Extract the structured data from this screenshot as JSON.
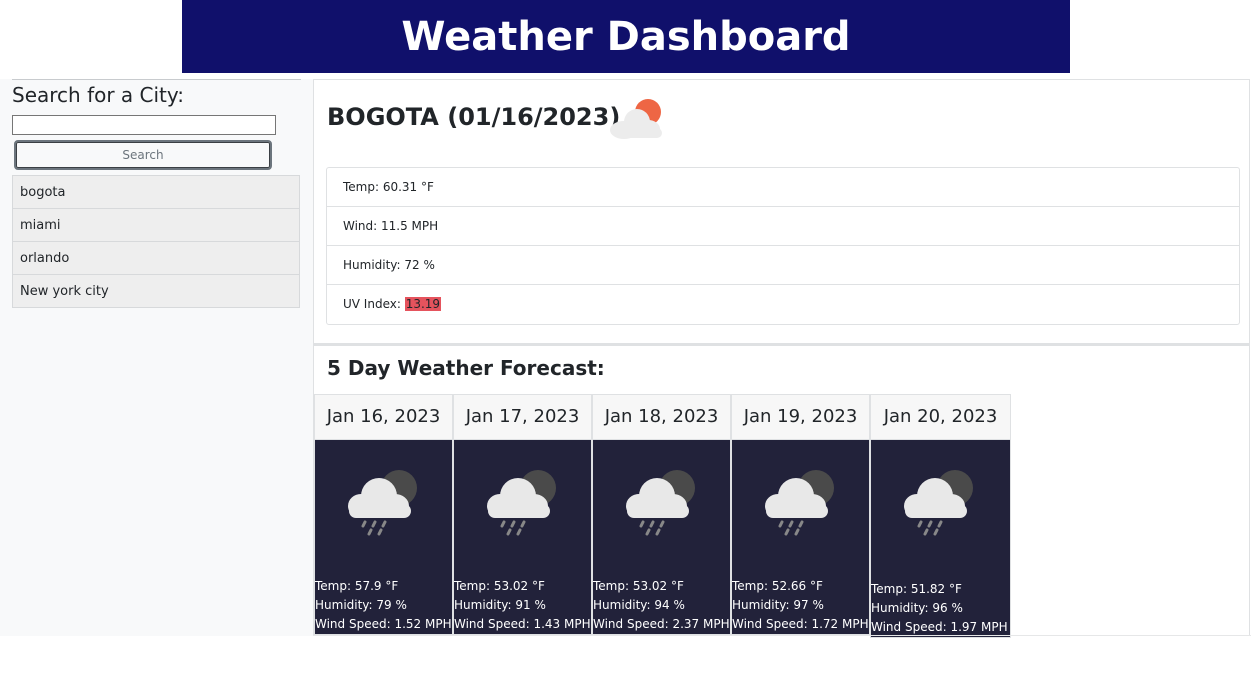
{
  "header": {
    "title": "Weather Dashboard"
  },
  "sidebar": {
    "title": "Search for a City:",
    "search_value": "",
    "search_placeholder": "",
    "search_button": "Search",
    "history": [
      "bogota",
      "miami",
      "orlando",
      "New york city"
    ]
  },
  "current": {
    "title": "BOGOTA (01/16/2023)",
    "icon": "partly-cloudy-icon",
    "temp": "Temp: 60.31 °F",
    "wind": "Wind: 11.5 MPH",
    "humidity": "Humidity: 72 %",
    "uv_label": "UV Index: ",
    "uv_value": "13.19",
    "uv_color": "#e5535d"
  },
  "forecast": {
    "title": "5 Day Weather Forecast:",
    "days": [
      {
        "date": "Jan 16, 2023",
        "icon": "rain-cloud-moon-icon",
        "temp": "Temp: 57.9 °F",
        "humidity": "Humidity: 79 %",
        "wind": "Wind Speed: 1.52 MPH"
      },
      {
        "date": "Jan 17, 2023",
        "icon": "rain-cloud-moon-icon",
        "temp": "Temp: 53.02 °F",
        "humidity": "Humidity: 91 %",
        "wind": "Wind Speed: 1.43 MPH"
      },
      {
        "date": "Jan 18, 2023",
        "icon": "rain-cloud-moon-icon",
        "temp": "Temp: 53.02 °F",
        "humidity": "Humidity: 94 %",
        "wind": "Wind Speed: 2.37 MPH"
      },
      {
        "date": "Jan 19, 2023",
        "icon": "rain-cloud-moon-icon",
        "temp": "Temp: 52.66 °F",
        "humidity": "Humidity: 97 %",
        "wind": "Wind Speed: 1.72 MPH"
      },
      {
        "date": "Jan 20, 2023",
        "icon": "rain-cloud-moon-icon",
        "temp": "Temp: 51.82 °F",
        "humidity": "Humidity: 96 %",
        "wind": "Wind Speed: 1.97 MPH"
      }
    ]
  },
  "colors": {
    "header_bg": "#10106b",
    "card_body_bg": "#22223a"
  }
}
